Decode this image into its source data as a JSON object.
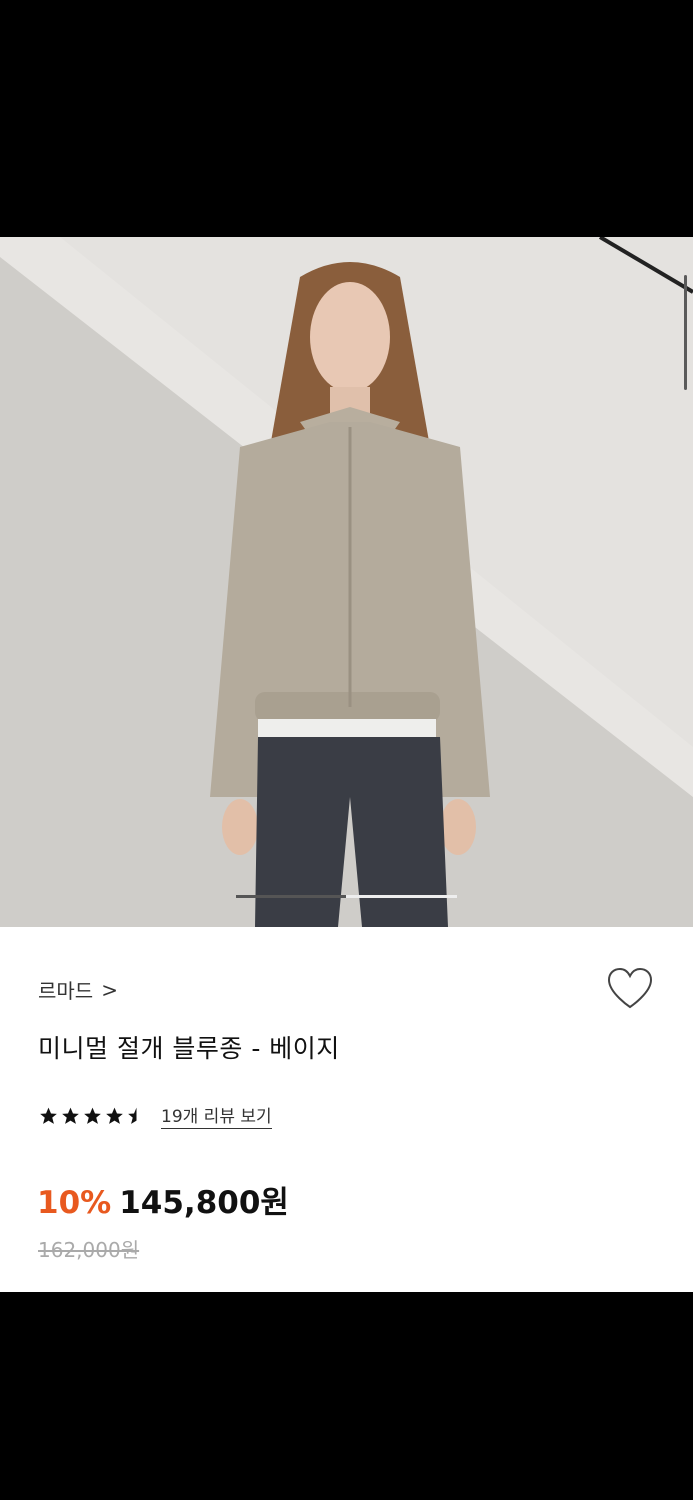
{
  "product": {
    "brand": "르마드",
    "brand_chevron": ">",
    "title": "미니멀 절개 블루종 - 베이지",
    "rating": 4.5,
    "review_link": "19개 리뷰 보기",
    "discount": "10%",
    "price": "145,800원",
    "original_price": "162,000원"
  },
  "gallery": {
    "current_slide": 1,
    "slide_count": 2
  },
  "colors": {
    "discount": "#e8591f",
    "background": "#ffffff"
  },
  "icons": {
    "favorite": "heart-outline-icon",
    "rating": "star-icon"
  }
}
